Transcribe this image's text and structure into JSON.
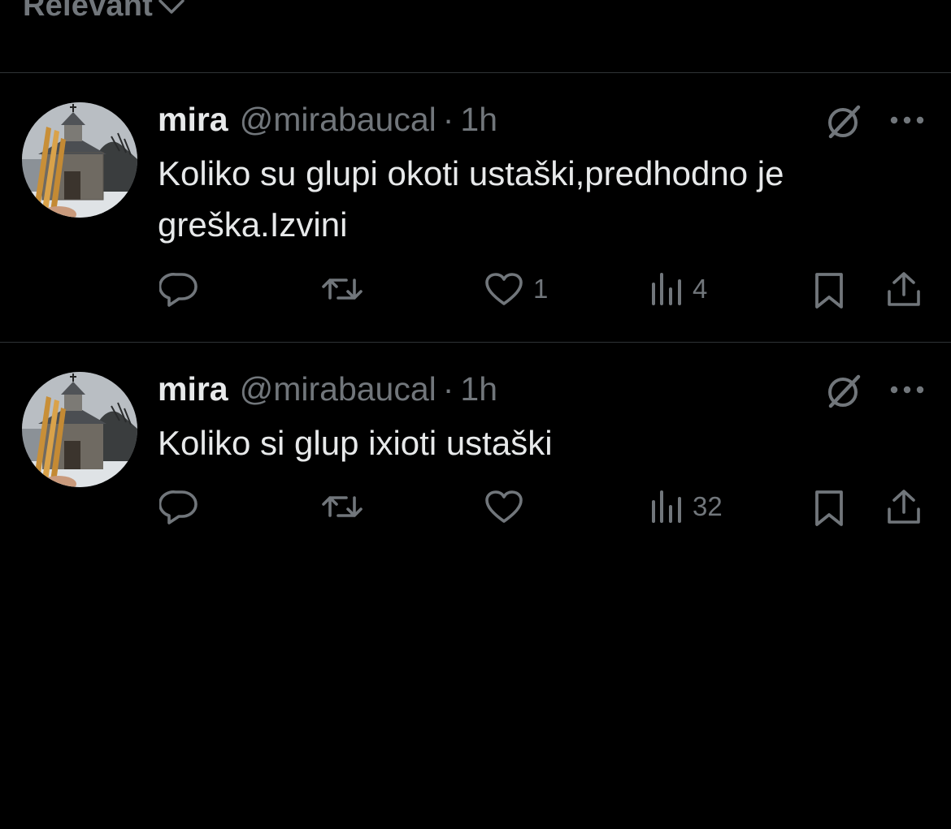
{
  "filter": {
    "label": "Relevant"
  },
  "tweets": [
    {
      "display_name": "mira",
      "handle": "@mirabaucal",
      "separator": "·",
      "time": "1h",
      "text": "Koliko su glupi okoti ustaški,predhodno je greška.Izvini",
      "likes": "1",
      "views": "4"
    },
    {
      "display_name": "mira",
      "handle": "@mirabaucal",
      "separator": "·",
      "time": "1h",
      "text": "Koliko si glup ixioti ustaški",
      "likes": "",
      "views": "32"
    }
  ],
  "icons": {
    "avatar": "church-photo-avatar",
    "grok": "grok-slash-icon",
    "more": "more-dots-icon",
    "reply": "reply-icon",
    "retweet": "retweet-icon",
    "like": "heart-icon",
    "views": "analytics-icon",
    "bookmark": "bookmark-icon",
    "share": "share-icon"
  },
  "colors": {
    "background": "#000000",
    "primary_text": "#e7e9ea",
    "secondary_text": "#71767b",
    "divider": "#2f3336"
  }
}
